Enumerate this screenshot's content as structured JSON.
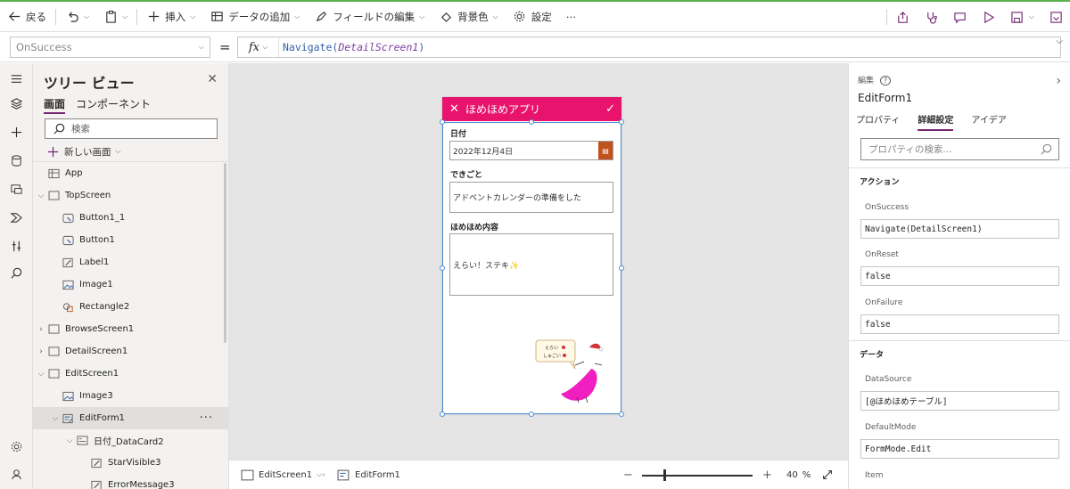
{
  "toolbar": {
    "back": "戻る",
    "insert": "挿入",
    "add_data": "データの追加",
    "edit_fields": "フィールドの編集",
    "background": "背景色",
    "settings": "設定",
    "more": "⋯"
  },
  "formula_bar": {
    "property": "OnSuccess",
    "equals": "=",
    "fx": "fx",
    "func": "Navigate(",
    "arg": "DetailScreen1",
    "close": ")"
  },
  "tree": {
    "title": "ツリー ビュー",
    "tabs": [
      "画面",
      "コンポーネント"
    ],
    "search_placeholder": "検索",
    "new_screen": "新しい画面",
    "items": [
      {
        "label": "App"
      },
      {
        "label": "TopScreen"
      },
      {
        "label": "Button1_1"
      },
      {
        "label": "Button1"
      },
      {
        "label": "Label1"
      },
      {
        "label": "Image1"
      },
      {
        "label": "Rectangle2"
      },
      {
        "label": "BrowseScreen1"
      },
      {
        "label": "DetailScreen1"
      },
      {
        "label": "EditScreen1"
      },
      {
        "label": "Image3"
      },
      {
        "label": "EditForm1"
      },
      {
        "label": "日付_DataCard2"
      },
      {
        "label": "StarVisible3"
      },
      {
        "label": "ErrorMessage3"
      }
    ]
  },
  "app_preview": {
    "header_title": "ほめほめアプリ",
    "header_color": "#e8136d",
    "field1_label": "日付",
    "field1_value": "2022年12月4日",
    "field2_label": "できごと",
    "field2_value": "アドベントカレンダーの準備をした",
    "field3_label": "ほめほめ内容",
    "field3_value": "えらい！ステキ✨",
    "sticker_line1": "えらい",
    "sticker_line2": "しゅごい"
  },
  "status": {
    "screen": "EditScreen1",
    "control": "EditForm1",
    "zoom": "40",
    "zoom_unit": "%"
  },
  "properties": {
    "header": "編集",
    "control_name": "EditForm1",
    "tabs": [
      "プロパティ",
      "詳細設定",
      "アイデア"
    ],
    "search_placeholder": "プロパティの検索...",
    "section_action": "アクション",
    "onsuccess_label": "OnSuccess",
    "onsuccess_value": "Navigate(DetailScreen1)",
    "onreset_label": "OnReset",
    "onreset_value": "false",
    "onfailure_label": "OnFailure",
    "onfailure_value": "false",
    "section_data": "データ",
    "datasource_label": "DataSource",
    "datasource_value": "[@ほめほめテーブル]",
    "defaultmode_label": "DefaultMode",
    "defaultmode_value": "FormMode.Edit",
    "item_label": "Item"
  }
}
